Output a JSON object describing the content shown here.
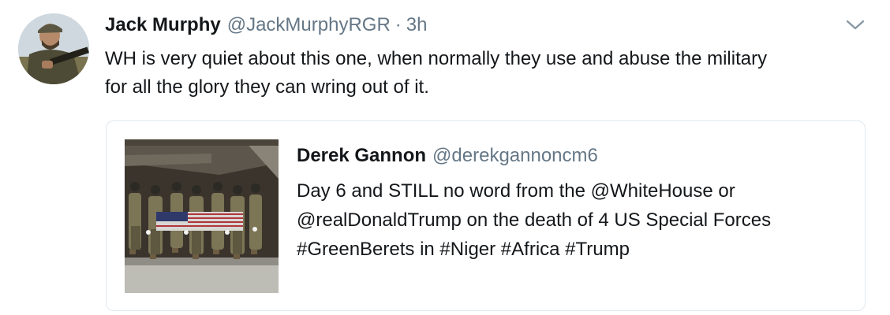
{
  "tweet": {
    "display_name": "Jack Murphy",
    "handle": "@JackMurphyRGR",
    "separator": "·",
    "time": "3h",
    "text": "WH is very quiet about this one, when normally they use and abuse the military\nfor all the glory they can wring out of it.",
    "avatar_icon": "profile-photo-soldier",
    "menu_icon": "chevron-down-icon"
  },
  "quoted_tweet": {
    "display_name": "Derek Gannon",
    "handle": "@derekgannoncm6",
    "text": "Day 6 and STILL no word from the @WhiteHouse or\n@realDonaldTrump on the death of 4 US Special Forces\n#GreenBerets in #Niger #Africa #Trump",
    "media_icon": "photo-soldiers-carrying-flag-draped-casket"
  },
  "colors": {
    "text_primary": "#14171a",
    "text_secondary": "#657786",
    "border": "#e1e8ed"
  }
}
